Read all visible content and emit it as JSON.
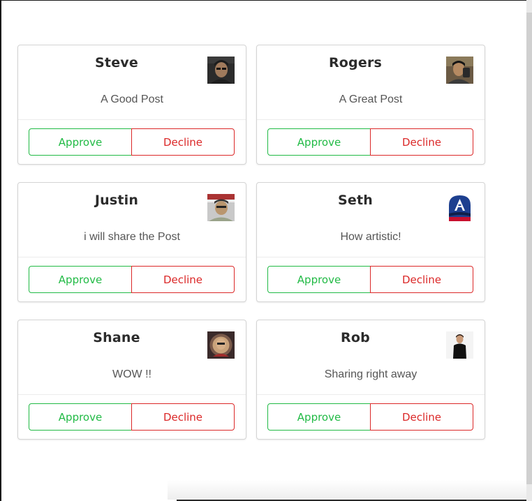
{
  "cards": [
    {
      "name": "Steve",
      "message": "A Good Post",
      "avatar_icon": "user-photo-icon",
      "approve_label": "Approve",
      "decline_label": "Decline"
    },
    {
      "name": "Rogers",
      "message": "A Great Post",
      "avatar_icon": "user-photo-icon",
      "approve_label": "Approve",
      "decline_label": "Decline"
    },
    {
      "name": "Justin",
      "message": "i will share the Post",
      "avatar_icon": "user-photo-icon",
      "approve_label": "Approve",
      "decline_label": "Decline"
    },
    {
      "name": "Seth",
      "message": "How artistic!",
      "avatar_icon": "user-photo-icon",
      "approve_label": "Approve",
      "decline_label": "Decline"
    },
    {
      "name": "Shane",
      "message": "WOW !!",
      "avatar_icon": "user-photo-icon",
      "approve_label": "Approve",
      "decline_label": "Decline"
    },
    {
      "name": "Rob",
      "message": "Sharing right away",
      "avatar_icon": "user-photo-icon",
      "approve_label": "Approve",
      "decline_label": "Decline"
    }
  ],
  "colors": {
    "approve": "#21ba45",
    "decline": "#db2828",
    "card_border": "#d4d4d4",
    "name_text": "#2b2b2b",
    "message_text": "#555555"
  }
}
